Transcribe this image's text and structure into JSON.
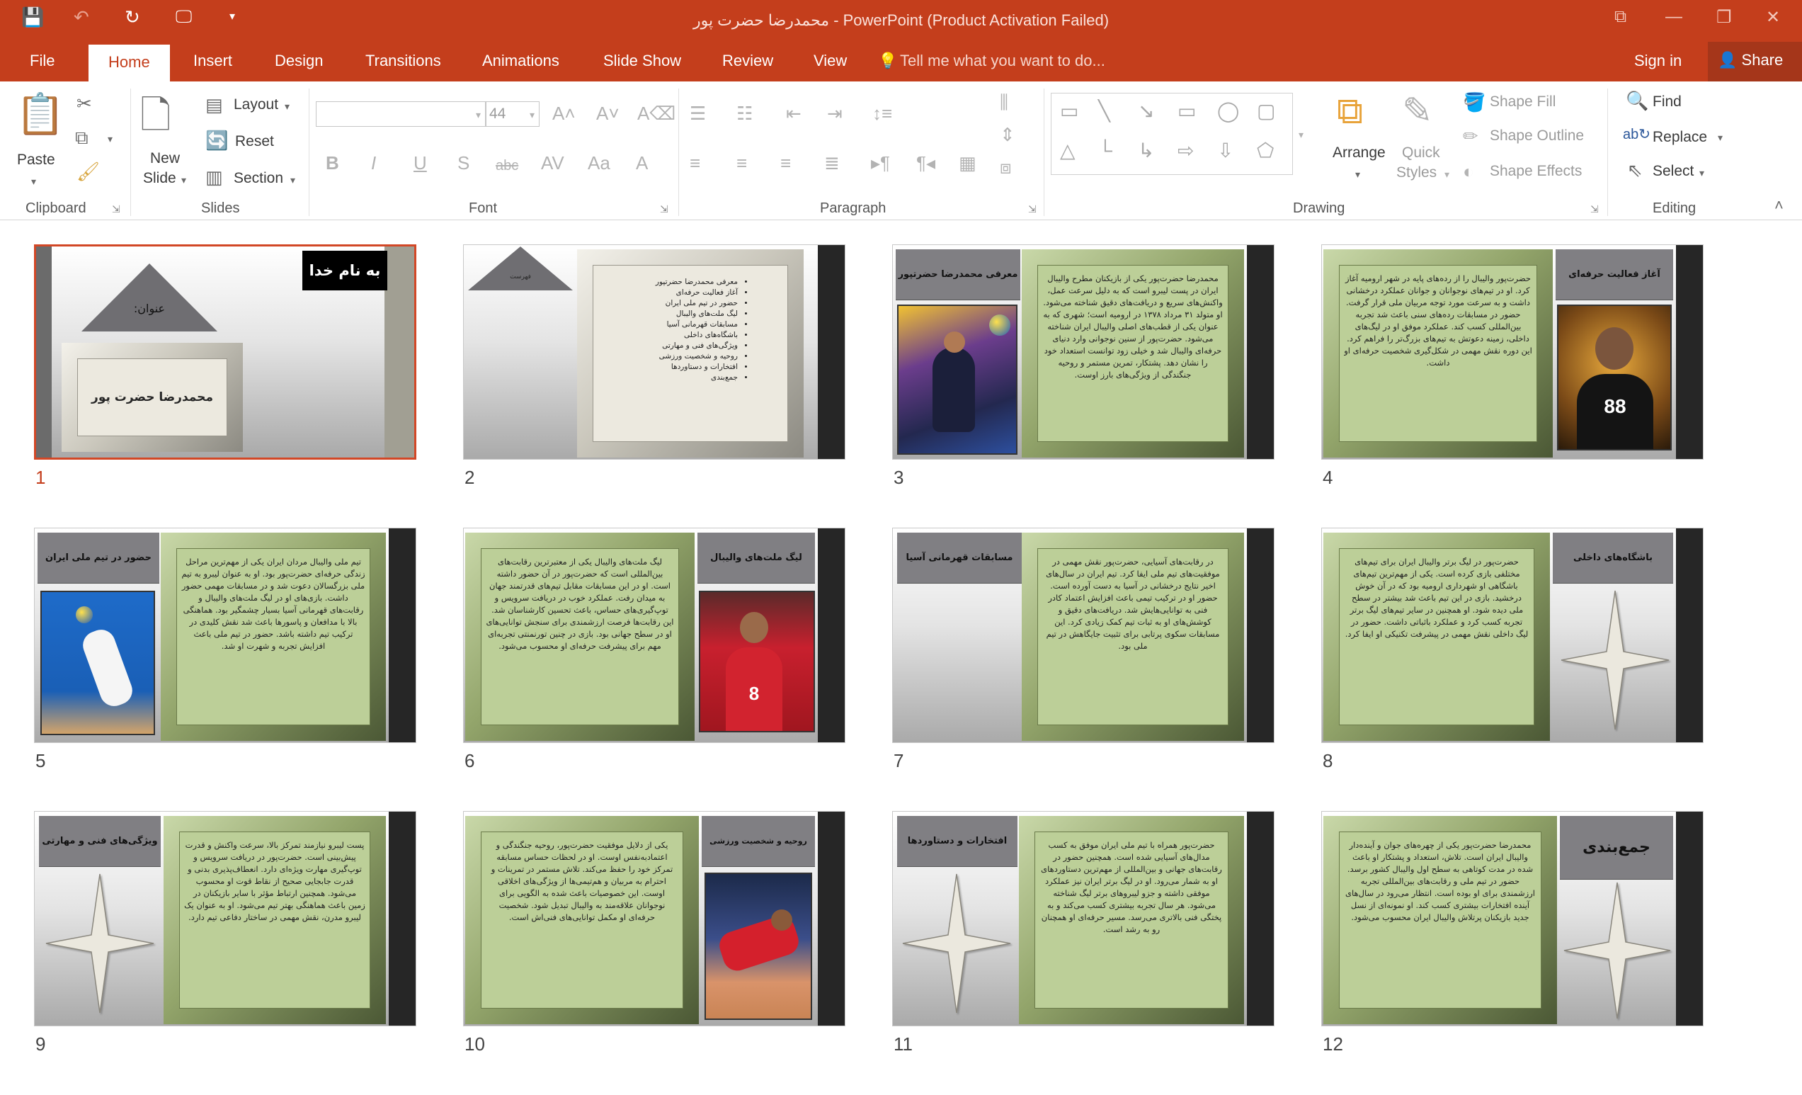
{
  "window": {
    "title": "محمدرضا حضرت پور - PowerPoint (Product Activation Failed)"
  },
  "tabs": [
    "File",
    "Home",
    "Insert",
    "Design",
    "Transitions",
    "Animations",
    "Slide Show",
    "Review",
    "View"
  ],
  "tell_me": "Tell me what you want to do...",
  "sign_in": "Sign in",
  "share": "Share",
  "ribbon": {
    "clipboard": {
      "label": "Clipboard",
      "paste": "Paste"
    },
    "slides": {
      "label": "Slides",
      "new_slide": "New",
      "new_slide2": "Slide",
      "layout": "Layout",
      "reset": "Reset",
      "section": "Section"
    },
    "font": {
      "label": "Font",
      "size": "44",
      "change_case": "Aa"
    },
    "paragraph": {
      "label": "Paragraph"
    },
    "drawing": {
      "label": "Drawing",
      "arrange": "Arrange",
      "quick": "Quick",
      "styles": "Styles",
      "shape_fill": "Shape Fill",
      "shape_outline": "Shape Outline",
      "shape_effects": "Shape Effects"
    },
    "editing": {
      "label": "Editing",
      "find": "Find",
      "replace": "Replace",
      "select": "Select"
    }
  },
  "slides": [
    {
      "num": "1",
      "badge": "به نام خدا",
      "tri": "عنوان:",
      "name": "محمدرضا حضرت پور"
    },
    {
      "num": "2",
      "tri": "فهرست",
      "items": [
        "معرفی محمدرضا حضرتپور",
        "آغاز فعالیت حرفه‌ای",
        "حضور در تیم ملی ایران",
        "لیگ ملت‌های والیبال",
        "مسابقات قهرمانی آسیا",
        "باشگاه‌های داخلی",
        "ویژگی‌های فنی و مهارتی",
        "روحیه و شخصیت ورزشی",
        "افتخارات و دستاوردها",
        "جمع‌بندی"
      ]
    },
    {
      "num": "3",
      "title": "معرفی محمدرضا حضرتپور",
      "text": "محمدرضا حضرت‌پور یکی از بازیکنان مطرح والیبال ایران در پست لیبرو است که به دلیل سرعت عمل، واکنش‌های سریع و دریافت‌های دقیق شناخته می‌شود. او متولد ۳۱ مرداد ۱۳۷۸ در ارومیه است؛ شهری که به عنوان یکی از قطب‌های اصلی والیبال ایران شناخته می‌شود. حضرت‌پور از سنین نوجوانی وارد دنیای حرفه‌ای والیبال شد و خیلی زود توانست استعداد خود را نشان دهد. پشتکار، تمرین مستمر و روحیه جنگندگی از ویژگی‌های بارز اوست."
    },
    {
      "num": "4",
      "title": "آغاز فعالیت حرفه‌ای",
      "text": "حضرت‌پور والیبال را از رده‌های پایه در شهر ارومیه آغاز کرد. او در تیم‌های نوجوانان و جوانان عملکرد درخشانی داشت و به سرعت مورد توجه مربیان ملی قرار گرفت. حضور در مسابقات رده‌های سنی باعث شد تجربه بین‌المللی کسب کند. عملکرد موفق او در لیگ‌های داخلی، زمینه دعوتش به تیم‌های بزرگ‌تر را فراهم کرد. این دوره نقش مهمی در شکل‌گیری شخصیت حرفه‌ای او داشت."
    },
    {
      "num": "5",
      "title": "حضور در تیم ملی ایران",
      "text": "تیم ملی والیبال مردان ایران یکی از مهم‌ترین مراحل زندگی حرفه‌ای حضرت‌پور بود. او به عنوان لیبرو به تیم ملی بزرگسالان دعوت شد و در مسابقات مهمی حضور داشت. بازی‌های او در لیگ ملت‌های والیبال و رقابت‌های قهرمانی آسیا بسیار چشمگیر بود. هماهنگی بالا با مدافعان و پاسورها باعث شد نقش کلیدی در ترکیب تیم داشته باشد. حضور در تیم ملی باعث افزایش تجربه و شهرت او شد."
    },
    {
      "num": "6",
      "title": "لیگ ملت‌های والیبال",
      "text": "لیگ ملت‌های والیبال یکی از معتبرترین رقابت‌های بین‌المللی است که حضرت‌پور در آن حضور داشته است. او در این مسابقات مقابل تیم‌های قدرتمند جهان به میدان رفت. عملکرد خوب در دریافت سرویس و توپ‌گیری‌های حساس، باعث تحسین کارشناسان شد. این رقابت‌ها فرصت ارزشمندی برای سنجش توانایی‌های او در سطح جهانی بود. بازی در چنین تورنمنتی تجربه‌ای مهم برای پیشرفت حرفه‌ای او محسوب می‌شود."
    },
    {
      "num": "7",
      "title": "مسابقات قهرمانی آسیا",
      "text": "در رقابت‌های آسیایی، حضرت‌پور نقش مهمی در موفقیت‌های تیم ملی ایفا کرد. تیم ایران در سال‌های اخیر نتایج درخشانی در آسیا به دست آورده است. حضور او در ترکیب تیمی باعث افزایش اعتماد کادر فنی به توانایی‌هایش شد. دریافت‌های دقیق و کوشش‌های او به ثبات تیم کمک زیادی کرد. این مسابقات سکوی پرتابی برای تثبیت جایگاهش در تیم ملی بود."
    },
    {
      "num": "8",
      "title": "باشگاه‌های داخلی",
      "text": "حضرت‌پور در لیگ برتر والیبال ایران برای تیم‌های مختلفی بازی کرده است. یکی از مهم‌ترین تیم‌های باشگاهی او شهرداری ارومیه بود که در آن خوش درخشید. بازی در این تیم باعث شد بیشتر در سطح ملی دیده شود. او همچنین در سایر تیم‌های لیگ برتر تجربه کسب کرد و عملکرد باثباتی داشت. حضور در لیگ داخلی نقش مهمی در پیشرفت تکنیکی او ایفا کرد."
    },
    {
      "num": "9",
      "title": "ویژگی‌های فنی و مهارتی",
      "text": "پست لیبرو نیازمند تمرکز بالا، سرعت واکنش و قدرت پیش‌بینی است. حضرت‌پور در دریافت سرویس و توپ‌گیری مهارت ویژه‌ای دارد. انعطاف‌پذیری بدنی و قدرت جابجایی صحیح از نقاط قوت او محسوب می‌شود. همچنین ارتباط مؤثر با سایر بازیکنان در زمین باعث هماهنگی بهتر تیم می‌شود. او به عنوان یک لیبرو مدرن، نقش مهمی در ساختار دفاعی تیم دارد."
    },
    {
      "num": "10",
      "title": "روحیه و شخصیت ورزشی",
      "text": "یکی از دلایل موفقیت حضرت‌پور، روحیه جنگندگی و اعتمادبه‌نفس اوست. او در لحظات حساس مسابقه تمرکز خود را حفظ می‌کند. تلاش مستمر در تمرینات و احترام به مربیان و هم‌تیمی‌ها از ویژگی‌های اخلاقی اوست. این خصوصیات باعث شده به الگویی برای نوجوانان علاقه‌مند به والیبال تبدیل شود. شخصیت حرفه‌ای او مکمل توانایی‌های فنی‌اش است."
    },
    {
      "num": "11",
      "title": "افتخارات و دستاوردها",
      "text": "حضرت‌پور همراه با تیم ملی ایران موفق به کسب مدال‌های آسیایی شده است. همچنین حضور در رقابت‌های جهانی و بین‌المللی از مهم‌ترین دستاوردهای او به شمار می‌رود. او در لیگ برتر ایران نیز عملکرد موفقی داشته و جزو لیبروهای برتر لیگ شناخته می‌شود. هر سال تجربه بیشتری کسب می‌کند و به پختگی فنی بالاتری می‌رسد. مسیر حرفه‌ای او همچنان رو به رشد است."
    },
    {
      "num": "12",
      "title": "جمع‌بندی",
      "text": "محمدرضا حضرت‌پور یکی از چهره‌های جوان و آینده‌دار والیبال ایران است. تلاش، استعداد و پشتکار او باعث شده در مدت کوتاهی به سطح اول والیبال کشور برسد. حضور در تیم ملی و رقابت‌های بین‌المللی تجربه ارزشمندی برای او بوده است. انتظار می‌رود در سال‌های آینده افتخارات بیشتری کسب کند. او نمونه‌ای از نسل جدید بازیکنان پرتلاش والیبال ایران محسوب می‌شود."
    }
  ]
}
